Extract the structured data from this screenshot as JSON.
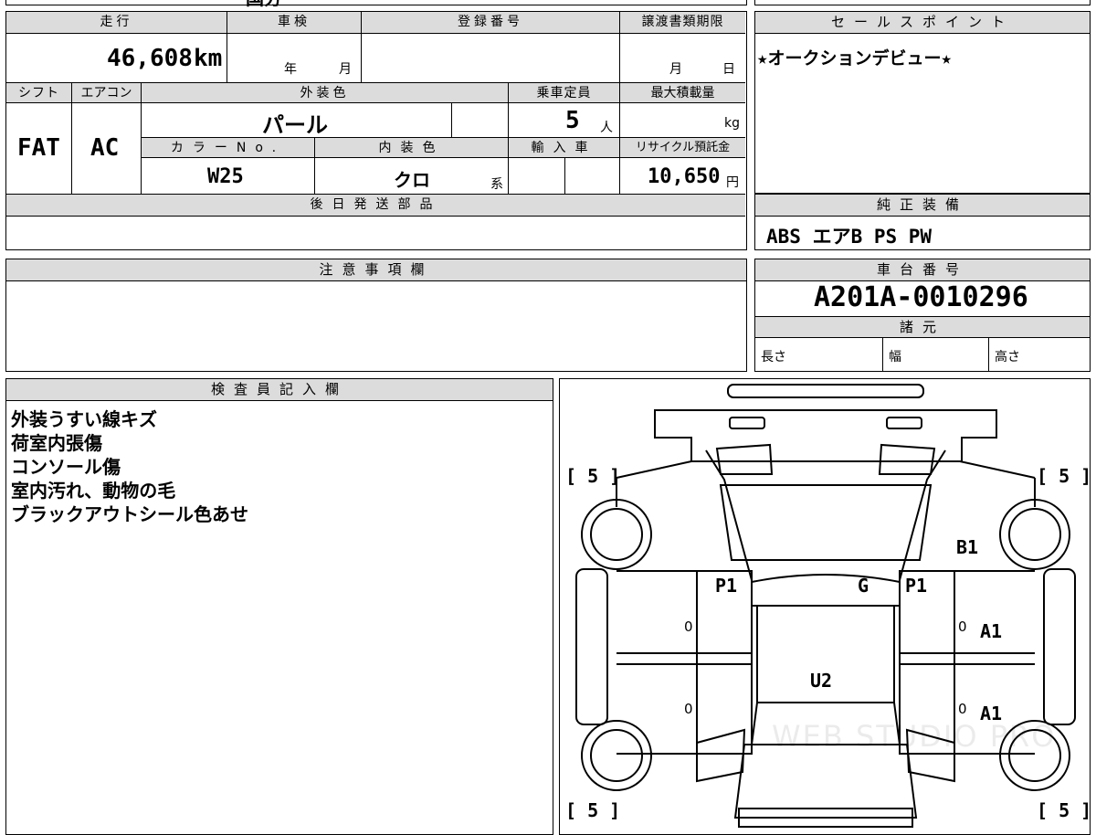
{
  "top_partial": {
    "a": "国分",
    "b": ""
  },
  "mileage": {
    "label": "走行",
    "value": "46,608",
    "unit": "km"
  },
  "inspection": {
    "label": "車検",
    "year_unit": "年",
    "month_unit": "月"
  },
  "registration": {
    "label": "登録番号",
    "value": ""
  },
  "transfer_deadline": {
    "label": "譲渡書類期限",
    "month_unit": "月",
    "day_unit": "日"
  },
  "sales_point": {
    "label": "セールスポイント",
    "text": "★オークションデビュー★"
  },
  "shift": {
    "label": "シフト",
    "value": "FAT"
  },
  "aircon": {
    "label": "エアコン",
    "value": "AC"
  },
  "exterior_color": {
    "label": "外装色",
    "value": "パール"
  },
  "capacity": {
    "label": "乗車定員",
    "value": "5",
    "unit": "人"
  },
  "max_load": {
    "label": "最大積載量",
    "value": "",
    "unit": "kg"
  },
  "color_no": {
    "label": "カラーNo.",
    "value": "W25"
  },
  "interior_color": {
    "label": "内装色",
    "value": "クロ",
    "suffix": "系"
  },
  "import": {
    "label": "輸入車",
    "value": ""
  },
  "recycle": {
    "label": "リサイクル預託金",
    "value": "10,650",
    "unit": "円"
  },
  "later_parts": {
    "label": "後日発送部品",
    "value": ""
  },
  "equipment": {
    "label": "純正装備",
    "value": "ABS エアB PS PW"
  },
  "notes": {
    "label": "注意事項欄",
    "value": ""
  },
  "chassis": {
    "label": "車台番号",
    "value": "A201A-0010296"
  },
  "specs": {
    "label": "諸元",
    "length": "長さ",
    "width": "幅",
    "height": "高さ"
  },
  "inspector": {
    "label": "検査員記入欄",
    "lines": [
      "外装うすい線キズ",
      "荷室内張傷",
      "コンソール傷",
      "室内汚れ、動物の毛",
      "ブラックアウトシール色あせ"
    ]
  },
  "diagram": {
    "tires": {
      "fl": "[ 5 ]",
      "fr": "[ 5 ]",
      "rl": "[ 5 ]",
      "rr": "[ 5 ]"
    },
    "marks": {
      "b1": "B1",
      "p1_left": "P1",
      "g": "G",
      "p1_right": "P1",
      "a1_front": "A1",
      "a1_rear": "A1",
      "u2": "U2"
    },
    "zeros": {
      "lf": "0",
      "lr": "0",
      "rf": "0",
      "rr": "0"
    },
    "watermark": "WEB STUDIO PRO"
  }
}
